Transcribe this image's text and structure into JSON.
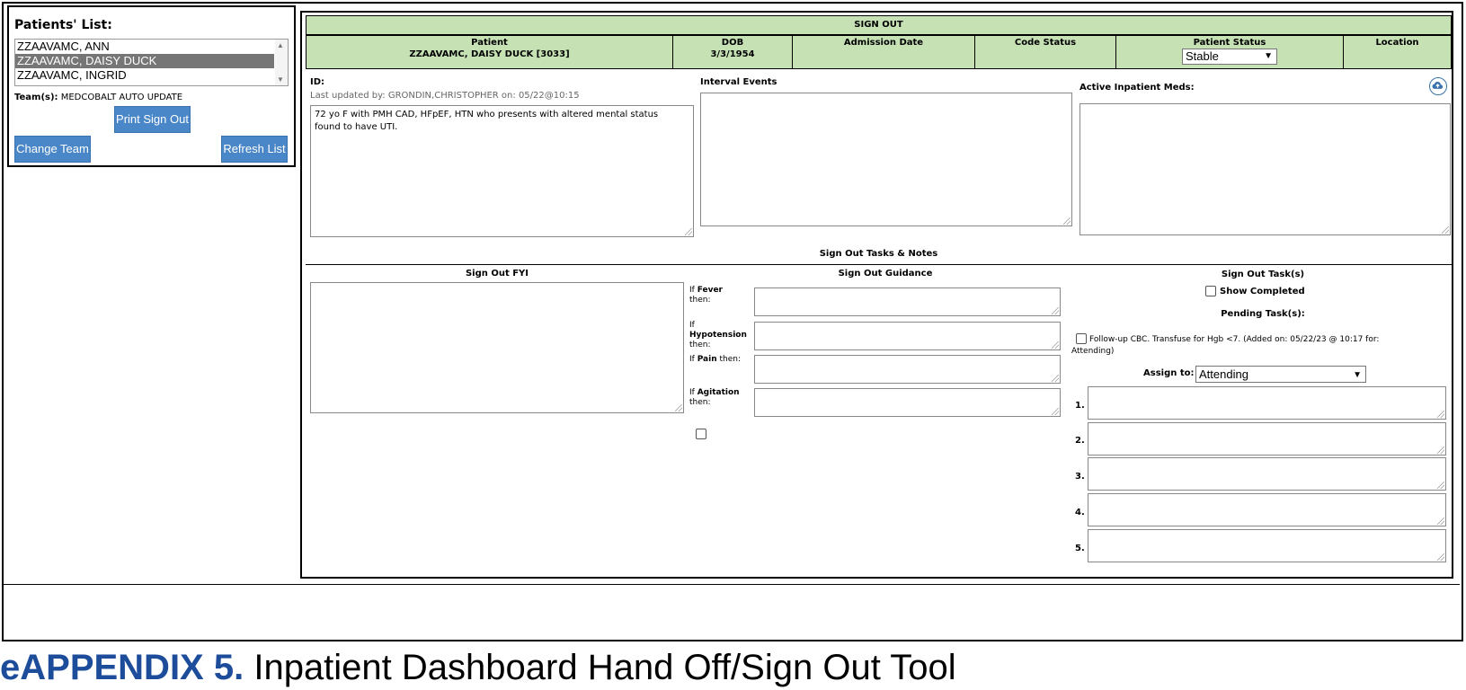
{
  "patients_list": {
    "title": "Patients' List:",
    "items": [
      "ZZAAVAMC, ANN",
      "ZZAAVAMC, DAISY DUCK",
      "ZZAAVAMC, INGRID"
    ],
    "selected_index": 1,
    "team_label": "Team(s):",
    "team_value": "MEDCOBALT AUTO UPDATE",
    "print_button": "Print Sign Out",
    "change_team_button": "Change Team",
    "refresh_button": "Refresh List"
  },
  "header": {
    "title": "SIGN OUT",
    "patient_label": "Patient",
    "patient_value": "ZZAAVAMC, DAISY DUCK [3033]",
    "dob_label": "DOB",
    "dob_value": "3/3/1954",
    "admission_label": "Admission Date",
    "code_label": "Code Status",
    "status_label": "Patient Status",
    "status_value": "Stable",
    "location_label": "Location"
  },
  "id_section": {
    "label": "ID:",
    "updated": "Last updated by: GRONDIN,CHRISTOPHER on: 05/22@10:15",
    "text_line1": "72 yo F with PMH CAD, HFpEF, HTN who presents with altered mental status",
    "text_line2": "found to have UTI."
  },
  "interval_events": {
    "label": "Interval Events"
  },
  "meds": {
    "label": "Active Inpatient Meds:",
    "icon": "cloud-upload-icon"
  },
  "tasks_notes": {
    "title": "Sign Out Tasks & Notes"
  },
  "fyi": {
    "label": "Sign Out FYI"
  },
  "guidance": {
    "label": "Sign Out Guidance",
    "if": "If",
    "then": "then:",
    "then_inline": " then:",
    "fever": "Fever",
    "hypotension": "Hypotension",
    "pain": "Pain",
    "agitation": "Agitation"
  },
  "tasks": {
    "label": "Sign Out Task(s)",
    "show_completed": "Show Completed",
    "pending_label": "Pending Task(s):",
    "pending_line1": "Follow-up CBC. Transfuse for Hgb <7. (Added on: 05/22/23 @ 10:17 for:",
    "pending_line2": "Attending)",
    "assign_label": "Assign to:",
    "assign_value": "Attending",
    "numbers": [
      "1.",
      "2.",
      "3.",
      "4.",
      "5."
    ]
  },
  "caption": {
    "bold": "eAPPENDIX 5.",
    "rest": " Inpatient Dashboard Hand Off/Sign Out Tool"
  }
}
